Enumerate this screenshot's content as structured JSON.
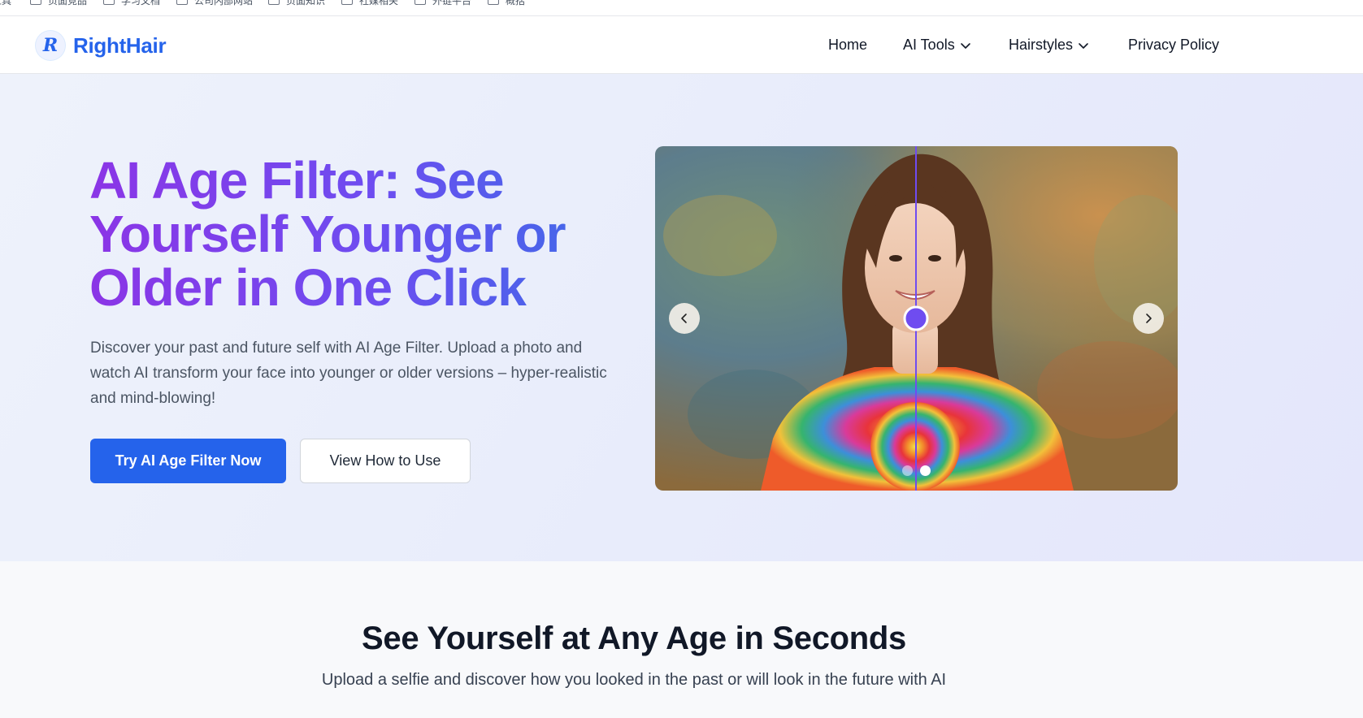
{
  "bookmarks": [
    {
      "label": "工具"
    },
    {
      "label": "页面竞品"
    },
    {
      "label": "学习文档"
    },
    {
      "label": "公司内部网站"
    },
    {
      "label": "页面知识"
    },
    {
      "label": "社媒相关"
    },
    {
      "label": "外链平台"
    },
    {
      "label": "概括"
    }
  ],
  "header": {
    "brand": "RightHair",
    "logo_letter": "R",
    "nav": [
      {
        "label": "Home",
        "has_dropdown": false
      },
      {
        "label": "AI Tools",
        "has_dropdown": true
      },
      {
        "label": "Hairstyles",
        "has_dropdown": true
      },
      {
        "label": "Privacy Policy",
        "has_dropdown": false
      }
    ]
  },
  "hero": {
    "title": "AI Age Filter: See Yourself Younger or Older in One Click",
    "subtitle": "Discover your past and future self with AI Age Filter. Upload a photo and watch AI transform your face into younger or older versions – hyper-realistic and mind-blowing!",
    "primary_cta": "Try AI Age Filter Now",
    "secondary_cta": "View How to Use",
    "slider": {
      "prev_icon": "chevron-left-icon",
      "next_icon": "chevron-right-icon",
      "slide_count": 2,
      "active_slide": 2,
      "divider_position": 0.5
    }
  },
  "section2": {
    "title": "See Yourself at Any Age in Seconds",
    "subtitle": "Upload a selfie and discover how you looked in the past or will look in the future with AI"
  },
  "colors": {
    "brand_blue": "#2563eb",
    "title_gradient_start": "#8b35e6",
    "title_gradient_end": "#3f6be8",
    "slider_handle": "#6f4cf0"
  }
}
